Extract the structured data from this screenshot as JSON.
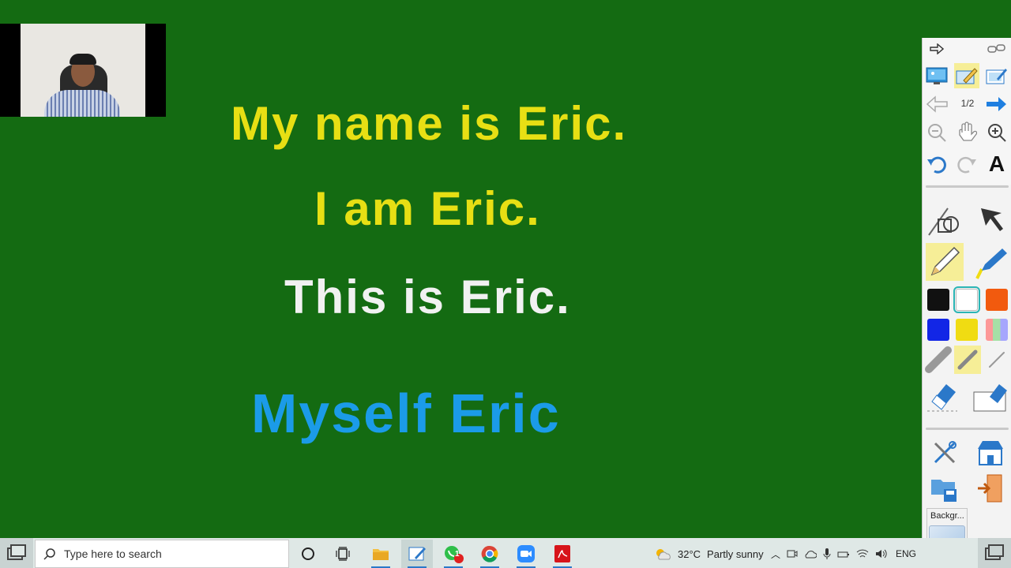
{
  "slide": {
    "lines": [
      {
        "text": "My name is Eric.",
        "color": "#e7df14"
      },
      {
        "text": "I am Eric.",
        "color": "#e7df14"
      },
      {
        "text": "This is Eric.",
        "color": "#f1f1f1"
      },
      {
        "text": "Myself Eric",
        "color": "#1b9be8"
      }
    ],
    "background_color": "#146b12"
  },
  "toolbar": {
    "page_indicator": "1/2",
    "text_tool_label": "A",
    "colors": [
      "#111111",
      "#ffffff",
      "#f25a0e",
      "#1226e6",
      "#f0dc12",
      "multicolor"
    ],
    "selected_color": "#ffffff",
    "background_panel_label": "Backgr..."
  },
  "taskbar": {
    "search_placeholder": "Type here to search",
    "whatsapp_badge": "1",
    "weather_temp": "32°C",
    "weather_desc": "Partly sunny",
    "language": "ENG"
  }
}
